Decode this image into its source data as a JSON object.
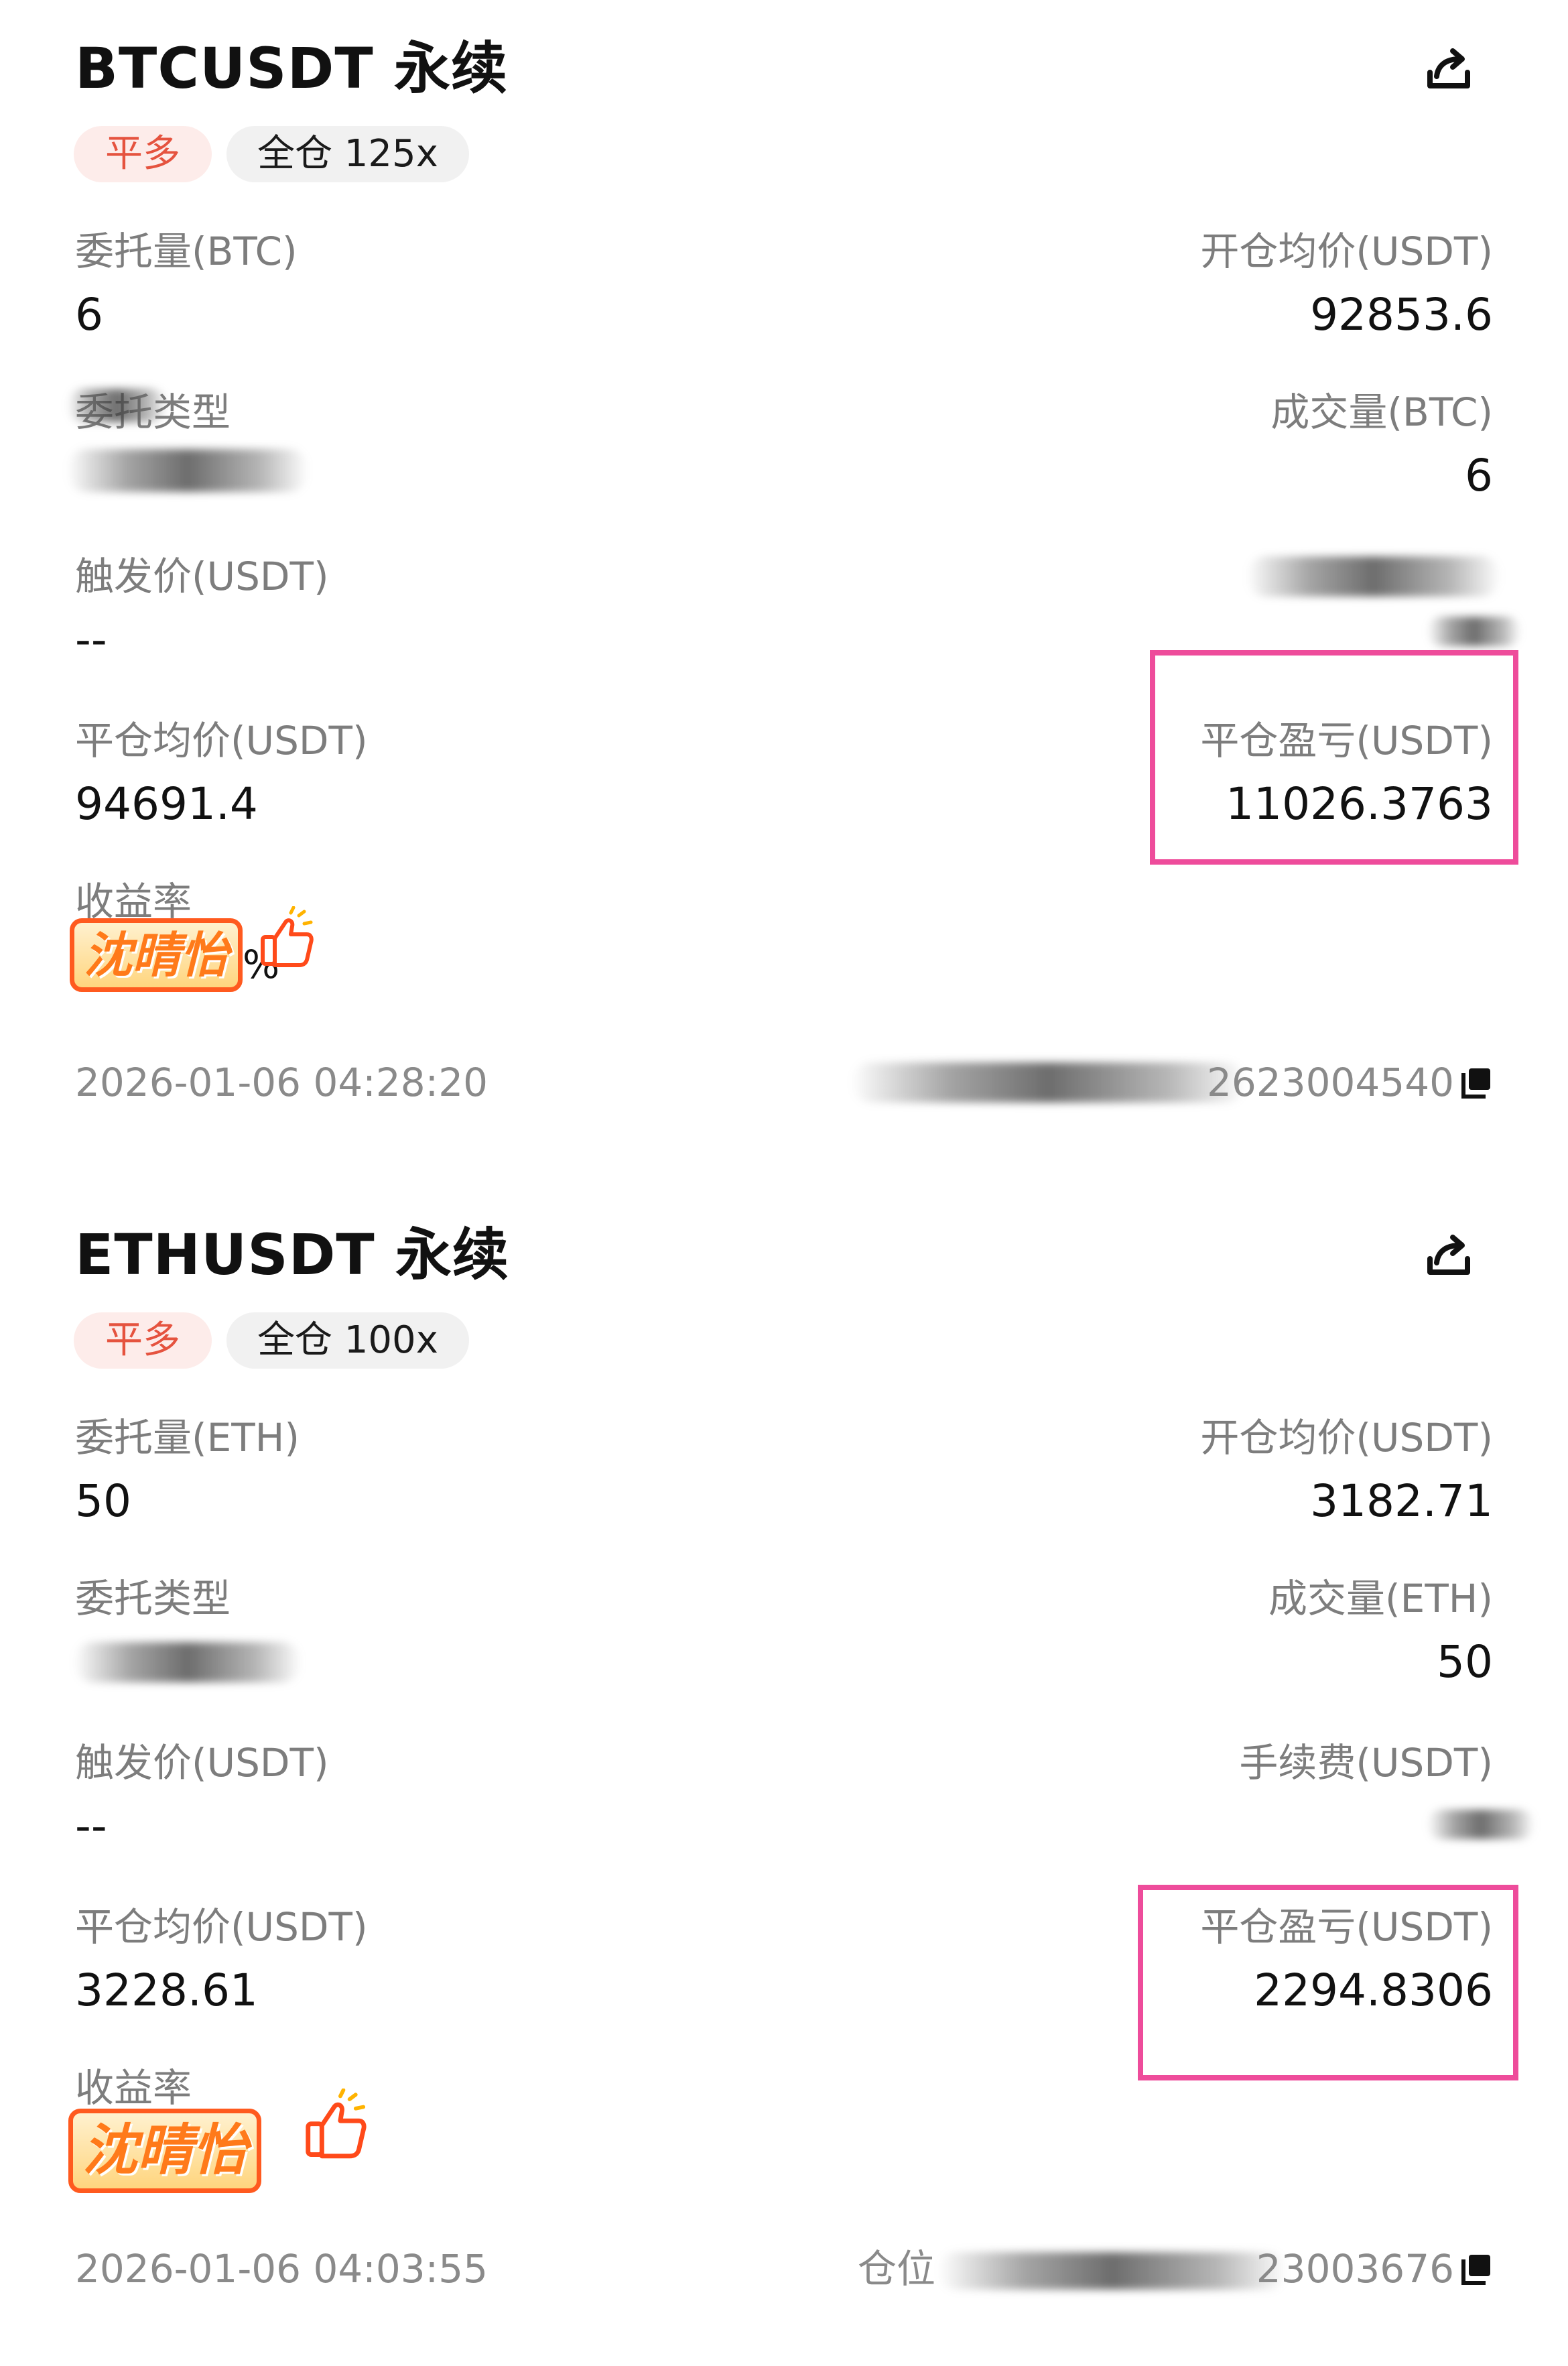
{
  "orders": [
    {
      "title": "BTCUSDT 永续",
      "side": "平多",
      "mode": "全仓 125x",
      "qty_label": "委托量(BTC)",
      "qty_value": "6",
      "open_avg_label": "开仓均价(USDT)",
      "open_avg_value": "92853.6",
      "order_type_label": "委托类型",
      "filled_label": "成交量(BTC)",
      "filled_value": "6",
      "trigger_label": "触发价(USDT)",
      "trigger_value": "--",
      "close_avg_label": "平仓均价(USDT)",
      "close_avg_value": "94691.4",
      "pnl_label": "平仓盈亏(USDT)",
      "pnl_value": "11026.3763",
      "yield_label": "收益率",
      "sticker_text": "沈晴怡",
      "pct_suffix": "%",
      "time": "2026-01-06 04:28:20",
      "position_id_visible": "2623004540"
    },
    {
      "title": "ETHUSDT 永续",
      "side": "平多",
      "mode": "全仓 100x",
      "qty_label": "委托量(ETH)",
      "qty_value": "50",
      "open_avg_label": "开仓均价(USDT)",
      "open_avg_value": "3182.71",
      "order_type_label": "委托类型",
      "filled_label": "成交量(ETH)",
      "filled_value": "50",
      "trigger_label": "触发价(USDT)",
      "trigger_value": "--",
      "fee_label": "手续费(USDT)",
      "close_avg_label": "平仓均价(USDT)",
      "close_avg_value": "3228.61",
      "pnl_label": "平仓盈亏(USDT)",
      "pnl_value": "2294.8306",
      "yield_label": "收益率",
      "sticker_text": "沈晴怡",
      "time": "2026-01-06 04:03:55",
      "position_id_prefix": "仓位",
      "position_id_visible": "23003676"
    }
  ],
  "icons": {
    "share": "share-icon",
    "copy": "copy-icon",
    "thumb": "thumbs-up-icon"
  },
  "colors": {
    "accent_red": "#e5533f",
    "highlight_pink": "#ee4c9b",
    "muted_text": "#7d7d7d"
  }
}
